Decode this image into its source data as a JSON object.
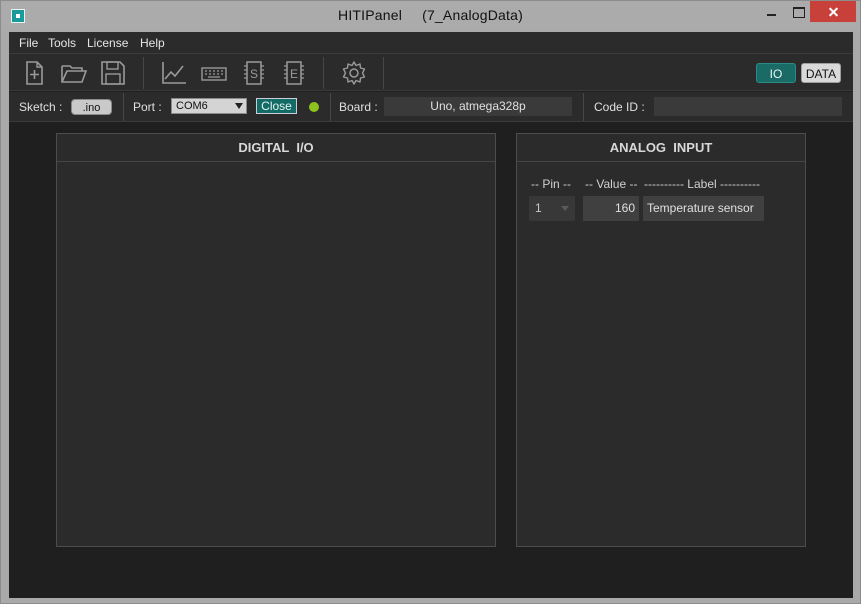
{
  "window": {
    "title": "HITIPanel",
    "subtitle": "(7_AnalogData)"
  },
  "menu": {
    "items": [
      {
        "label": "File"
      },
      {
        "label": "Tools"
      },
      {
        "label": "License"
      },
      {
        "label": "Help"
      }
    ]
  },
  "toolbar": {
    "icons": [
      "new-file-icon",
      "open-folder-icon",
      "save-icon",
      "chart-icon",
      "keyboard-icon",
      "chip-s-icon",
      "chip-e-icon",
      "gear-icon"
    ],
    "io_label": "IO",
    "data_label": "DATA"
  },
  "info": {
    "sketch_label": "Sketch :",
    "sketch_button": ".ino",
    "port_label": "Port :",
    "port_value": "COM6",
    "close_label": "Close",
    "board_label": "Board :",
    "board_value": "Uno, atmega328p",
    "code_id_label": "Code ID :",
    "code_id_value": ""
  },
  "digital": {
    "title": "DIGITAL  I/O"
  },
  "analog": {
    "title": "ANALOG  INPUT",
    "col_pin": "-- Pin --",
    "col_value": "-- Value --",
    "col_label": "---------- Label ----------",
    "rows": [
      {
        "pin": "1",
        "value": "160",
        "label": "Temperature sensor"
      }
    ]
  },
  "colors": {
    "accent": "#1a6b66",
    "led": "#8ec21c",
    "close_button": "#c7413a"
  }
}
